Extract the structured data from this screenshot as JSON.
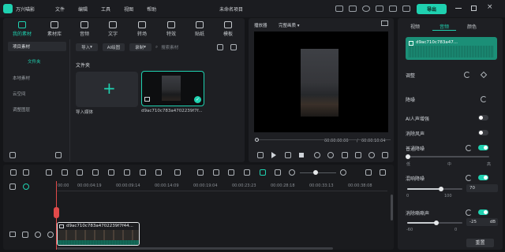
{
  "app": {
    "name": "万兴喵影",
    "project_title": "未命名项目",
    "menu": [
      "文件",
      "编辑",
      "工具",
      "视图",
      "帮助"
    ],
    "export_label": "导出"
  },
  "colors": {
    "accent": "#1fd1b0",
    "playhead": "#e24a4a"
  },
  "toolbar": {
    "tabs": [
      {
        "label": "我的素材",
        "icon": "folder-icon"
      },
      {
        "label": "素材库",
        "icon": "library-icon"
      },
      {
        "label": "音频",
        "icon": "music-icon"
      },
      {
        "label": "文字",
        "icon": "text-icon"
      },
      {
        "label": "转场",
        "icon": "transition-icon"
      },
      {
        "label": "特效",
        "icon": "effect-icon"
      },
      {
        "label": "贴纸",
        "icon": "sticker-icon"
      },
      {
        "label": "模板",
        "icon": "template-icon"
      }
    ]
  },
  "sidebar": {
    "header": "项目素材",
    "items": [
      "文件夹",
      "本地素材",
      "云空间",
      "调整图层"
    ]
  },
  "media": {
    "import_btn": "导入",
    "ai_btn": "AI绘图",
    "record_btn": "录制",
    "search_placeholder": "搜索素材",
    "folder_label": "文件夹",
    "import_label": "导入媒体",
    "clip_name": "d9ac710c783a4702239f7f..."
  },
  "player": {
    "tab_label": "播放器",
    "quality": "完整画质",
    "current_time": "00:00:00:00",
    "separator": "/",
    "total_time": "00:00:10:04"
  },
  "inspector": {
    "tabs": [
      "视频",
      "音频",
      "颜色"
    ],
    "clip_name": "d9ac710c783a47...",
    "sections": {
      "adjust": "调整",
      "denoise": "降噪",
      "ai_voice": "AI人声增强",
      "remove_wind": "消除风声",
      "normal_denoise": "普通降噪",
      "levels": [
        "低",
        "中",
        "高"
      ],
      "hum_denoise": "混响降噪",
      "hum_value": "70",
      "hum_min": "0",
      "hum_max": "100",
      "hiss_denoise": "消除嘶嘶声",
      "hiss_value": "-25",
      "hiss_unit": "dB",
      "hiss_min": "-60",
      "hiss_max": "0",
      "reset_label": "重置"
    }
  },
  "timeline": {
    "ruler": [
      "00:00",
      "00:00:04:19",
      "00:00:09:14",
      "00:00:14:09",
      "00:00:19:04",
      "00:00:23:23",
      "00:00:28:18",
      "00:00:33:13",
      "00:00:38:08"
    ],
    "track_clip": "d9ac710c783a4702239f7f44..."
  }
}
